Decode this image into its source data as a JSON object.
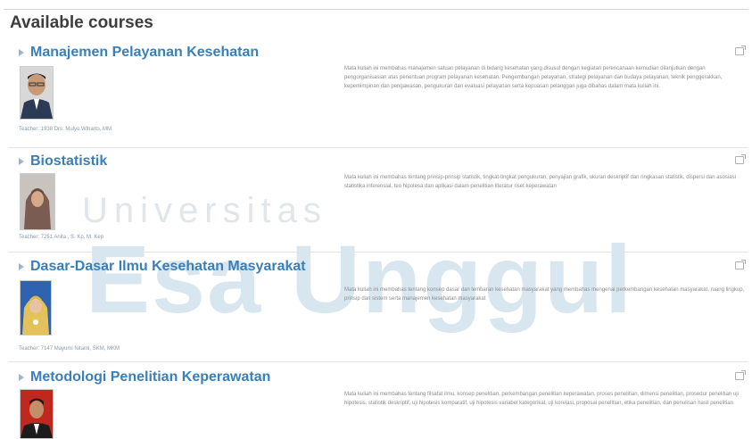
{
  "page": {
    "title": "Available courses",
    "watermark": {
      "line1": "Universitas",
      "line2": "Esa Unggul"
    }
  },
  "courses": [
    {
      "title": "Manajemen Pelayanan Kesehatan",
      "teacher": "Teacher: 1938 Drs. Mulyo Wiharto, MM",
      "summary": "Mata kuliah ini membahas manajemen satuan pelayanan di bidang kesehatan yang disusul dengan kegiatan perencanaan kemudian dilanjutkan dengan pengorganisasian atas penentuan program pelayanan kesehatan. Pengembangan pelayanan, strategi pelayanan dan budaya pelayanan, teknik penggerakkan, kepemimpinan dan pengawasan, pengukuran dan evaluasi pelayanan serta kepuasan pelanggan juga dibahas dalam mata kuliah ini."
    },
    {
      "title": "Biostatistik",
      "teacher": "Teacher: 7251 Anita , S. Kp, M. Kep",
      "summary": "Mata kuliah ini membahas tentang prinsip-prinsip statistik, tingkat-tingkat pengukuran, penyajian grafik, ukuran deskriptif dan ringkasan statistik, dispersi dan asosiasi statistika inferensial, teo hipotesa dan aplikasi dalam penelitian literatur riset keperawatan"
    },
    {
      "title": "Dasar-Dasar Ilmu Kesehatan Masyarakat",
      "teacher": "Teacher: 7147 Mayumi Nitami, SKM, MKM",
      "summary": "Mata kuliah ini membahas tentang konsep dasar dan lembaran kesehatan masyarakat yang membahas mengenai perkembangan kesehatan masyarakat, ruang lingkup, prinsip dan sistem serta manajemen kesehatan masyarakat"
    },
    {
      "title": "Metodologi Penelitian Keperawatan",
      "teacher": "",
      "summary": "Mata kuliah ini membahas tentang filsafat ilmu, konsep penelitian, perkembangan penelitian keperawatan, proses penelitian, dimensi penelitian, prosedur penelitian uji hipotesis, statistik deskriptif, uji hipotesis komparatif, uji hipotesis variabel kategorikal, uji korelasi, proposal penelitian, etika penelitian, dan penulisan hasil penelitian"
    }
  ]
}
